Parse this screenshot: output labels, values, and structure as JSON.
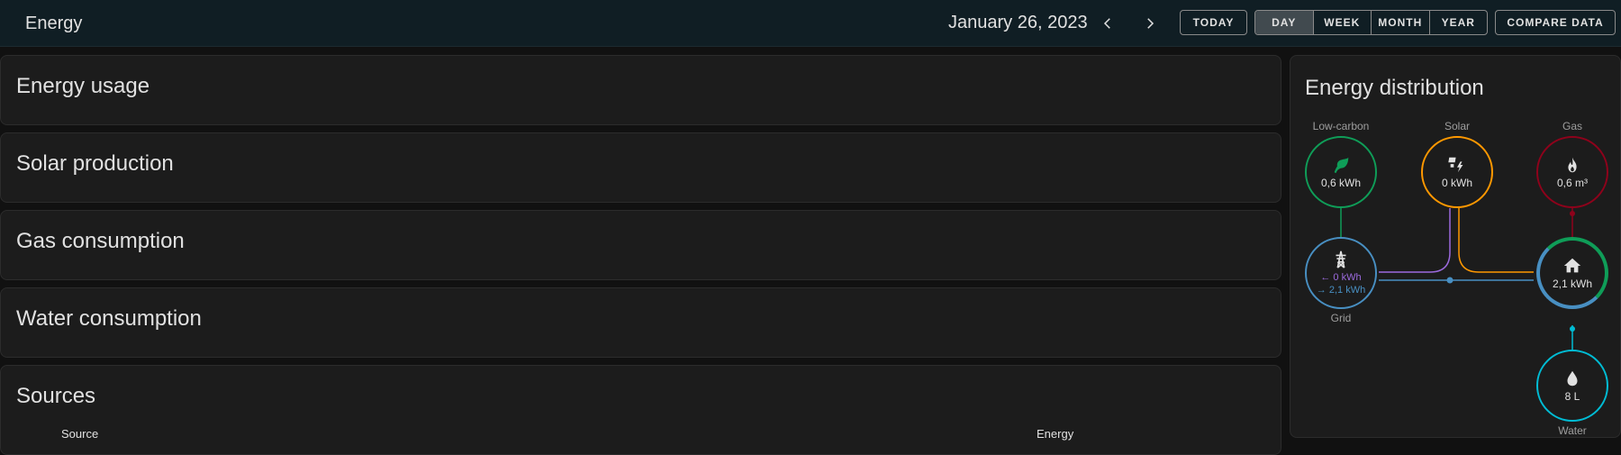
{
  "topbar": {
    "title": "Energy",
    "date": "January 26, 2023",
    "today_label": "TODAY",
    "periods": [
      "DAY",
      "WEEK",
      "MONTH",
      "YEAR"
    ],
    "active_period": "DAY",
    "compare_label": "COMPARE DATA"
  },
  "cards": {
    "usage": "Energy usage",
    "solar": "Solar production",
    "gas": "Gas consumption",
    "water": "Water consumption",
    "sources": {
      "title": "Sources",
      "col_source": "Source",
      "col_energy": "Energy"
    }
  },
  "distribution": {
    "title": "Energy distribution",
    "low_carbon": {
      "label": "Low-carbon",
      "value": "0,6 kWh",
      "icon": "leaf-icon",
      "color": "#0f9d58"
    },
    "solar": {
      "label": "Solar",
      "value": "0 kWh",
      "icon": "solar-power-icon",
      "color": "#ff9800"
    },
    "gas": {
      "label": "Gas",
      "value": "0,6 m³",
      "icon": "fire-icon",
      "color": "#8e021b"
    },
    "grid": {
      "label": "Grid",
      "return": "0 kWh",
      "consumption": "2,1 kWh",
      "icon": "transmission-tower-icon",
      "color": "#488fc2"
    },
    "home": {
      "value": "2,1 kWh",
      "icon": "home-icon"
    },
    "water": {
      "label": "Water",
      "value": "8 L",
      "icon": "water-drop-icon",
      "color": "#00bcd4"
    }
  }
}
